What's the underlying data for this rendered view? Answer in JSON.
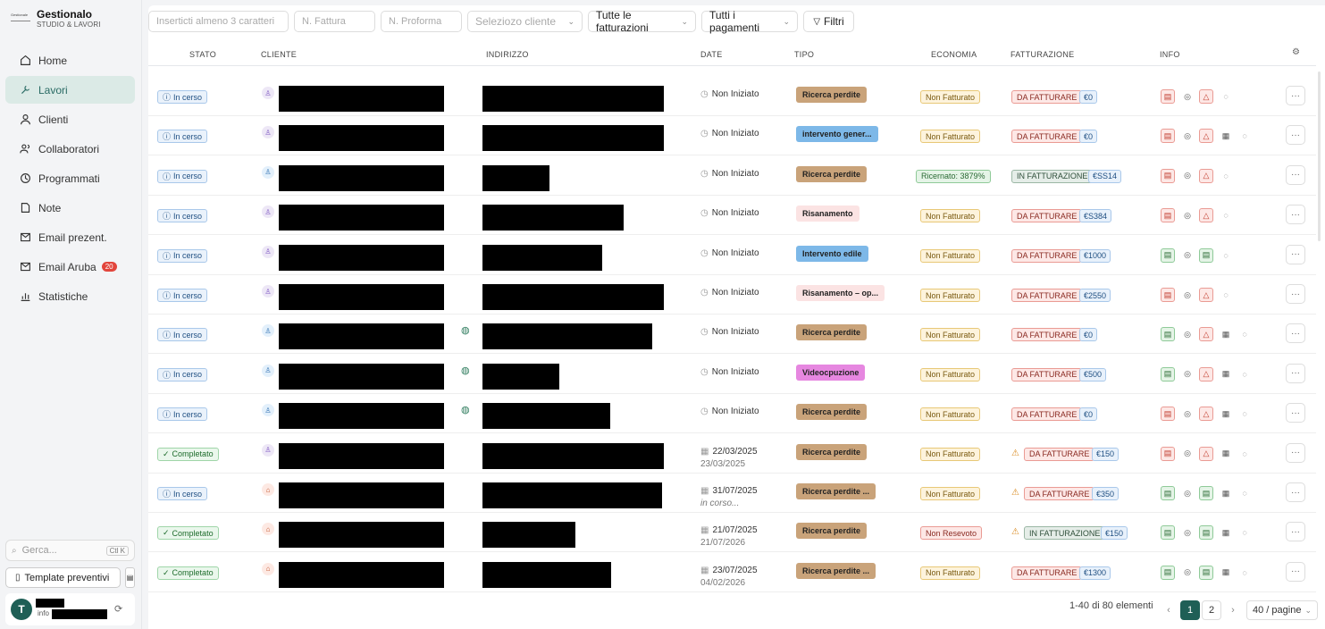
{
  "app": {
    "title": "Gestionalo",
    "subtitle": "STUDIO & LAVORI",
    "logo_text": "Gestionale"
  },
  "sidebar": {
    "items": [
      {
        "label": "Home",
        "icon": "home-icon"
      },
      {
        "label": "Lavori",
        "icon": "wrench-icon",
        "active": true
      },
      {
        "label": "Clienti",
        "icon": "user-icon"
      },
      {
        "label": "Collaboratori",
        "icon": "users-icon"
      },
      {
        "label": "Programmati",
        "icon": "clock-icon"
      },
      {
        "label": "Note",
        "icon": "note-icon"
      },
      {
        "label": "Email prezent.",
        "icon": "mail-icon"
      },
      {
        "label": "Email Aruba",
        "icon": "mail-icon",
        "badge": "20"
      },
      {
        "label": "Statistiche",
        "icon": "chart-icon"
      }
    ],
    "search_placeholder": "Gerca...",
    "search_shortcut": "Ctl K",
    "template_label": "Template preventivi",
    "user_initial": "T",
    "user_mail_prefix": "info"
  },
  "toolbar": {
    "search_placeholder": "Inserticti almeno 3 caratteri",
    "fattura_placeholder": "N. Fattura",
    "proforma_placeholder": "N. Proforma",
    "cliente_placeholder": "Seleziozo cliente",
    "fatturazioni": "Tutte le fatturazioni",
    "pagamenti": "Tutti i pagamenti",
    "filtri": "Filtri"
  },
  "table": {
    "headers": {
      "stato": "STATO",
      "cliente": "CLIENTE",
      "indirizzo": "INDIRIZZO",
      "date": "DATE",
      "tipo": "TIPO",
      "economia": "ECONOMIA",
      "fatturazione": "FATTURAZIONE",
      "info": "INFO"
    },
    "rows": [
      {
        "stato": "In cerso",
        "st": "inc",
        "ci": "p",
        "cw": 185,
        "aw": 203,
        "globe": false,
        "d1": "Non Iniziato",
        "d2": "",
        "tipo": "Ricerca perdite",
        "tc": "#c9a37a",
        "eco": "Non Fatturato",
        "ec": "nf",
        "warn": false,
        "fatt": "DA FATTURARE",
        "fc": "da",
        "amt": "€0",
        "pdf": "r",
        "alert": true,
        "cal": false
      },
      {
        "stato": "In cerso",
        "st": "inc",
        "ci": "p",
        "cw": 185,
        "aw": 203,
        "globe": false,
        "d1": "Non Iniziato",
        "d2": "",
        "tipo": "intervento gener...",
        "tc": "#7db8e8",
        "eco": "Non Fatturato",
        "ec": "nf",
        "warn": false,
        "fatt": "DA FATTURARE",
        "fc": "da",
        "amt": "€0",
        "pdf": "r",
        "alert": true,
        "cal": true
      },
      {
        "stato": "In cerso",
        "st": "inc",
        "ci": "b",
        "cw": 185,
        "aw": 75,
        "globe": false,
        "d1": "Non Iniziato",
        "d2": "",
        "tipo": "Ricerca perdite",
        "tc": "#c9a37a",
        "eco": "Ricernato: 3879%",
        "ec": "ric",
        "warn": false,
        "fatt": "IN FATTURAZIONE",
        "fc": "in",
        "amt": "€SS14",
        "pdf": "r",
        "alert": true,
        "cal": false
      },
      {
        "stato": "In cerso",
        "st": "inc",
        "ci": "p",
        "cw": 185,
        "aw": 158,
        "globe": false,
        "d1": "Non Iniziato",
        "d2": "",
        "tipo": "Risanamento",
        "tc": "#fbe3e3",
        "eco": "Non Fatturato",
        "ec": "nf",
        "warn": false,
        "fatt": "DA FATTURARE",
        "fc": "da",
        "amt": "€S384",
        "pdf": "r",
        "alert": true,
        "cal": false
      },
      {
        "stato": "In cerso",
        "st": "inc",
        "ci": "p",
        "cw": 185,
        "aw": 134,
        "globe": false,
        "d1": "Non Iniziato",
        "d2": "",
        "tipo": "Intervento edile",
        "tc": "#7db8e8",
        "eco": "Non Fatturato",
        "ec": "nf",
        "warn": false,
        "fatt": "DA FATTURARE",
        "fc": "da",
        "amt": "€1000",
        "pdf": "g",
        "alert": false,
        "cal": false
      },
      {
        "stato": "In cerso",
        "st": "inc",
        "ci": "p",
        "cw": 185,
        "aw": 203,
        "globe": false,
        "d1": "Non Iniziato",
        "d2": "",
        "tipo": "Risanamento – op...",
        "tc": "#fbe3e3",
        "eco": "Non Fatturato",
        "ec": "nf",
        "warn": false,
        "fatt": "DA FATTURARE",
        "fc": "da",
        "amt": "€2550",
        "pdf": "r",
        "alert": true,
        "cal": false
      },
      {
        "stato": "In cerso",
        "st": "inc",
        "ci": "b",
        "cw": 185,
        "aw": 190,
        "globe": true,
        "d1": "Non Iniziato",
        "d2": "",
        "tipo": "Ricerca perdite",
        "tc": "#c9a37a",
        "eco": "Non Fatturato",
        "ec": "nf",
        "warn": false,
        "fatt": "DA FATTURARE",
        "fc": "da",
        "amt": "€0",
        "pdf": "g",
        "alert": true,
        "cal": true
      },
      {
        "stato": "In cerso",
        "st": "inc",
        "ci": "b",
        "cw": 185,
        "aw": 86,
        "globe": true,
        "d1": "Non Iniziato",
        "d2": "",
        "tipo": "Videocpuzione",
        "tc": "#e687e0",
        "eco": "Non Fatturato",
        "ec": "nf",
        "warn": false,
        "fatt": "DA FATTURARE",
        "fc": "da",
        "amt": "€500",
        "pdf": "g",
        "alert": true,
        "cal": true
      },
      {
        "stato": "In cerso",
        "st": "inc",
        "ci": "b",
        "cw": 185,
        "aw": 143,
        "globe": true,
        "d1": "Non Iniziato",
        "d2": "",
        "tipo": "Ricerca perdite",
        "tc": "#c9a37a",
        "eco": "Non Fatturato",
        "ec": "nf",
        "warn": false,
        "fatt": "DA FATTURARE",
        "fc": "da",
        "amt": "€0",
        "pdf": "r",
        "alert": true,
        "cal": true
      },
      {
        "stato": "Completato",
        "st": "comp",
        "ci": "p",
        "cw": 185,
        "aw": 203,
        "globe": false,
        "d1": "22/03/2025",
        "d2": "23/03/2025",
        "tipo": "Ricerca perdite",
        "tc": "#c9a37a",
        "eco": "Non Fatturato",
        "ec": "nf",
        "warn": true,
        "fatt": "DA FATTURARE",
        "fc": "da",
        "amt": "€150",
        "pdf": "r",
        "alert": true,
        "cal": true
      },
      {
        "stato": "In cerso",
        "st": "inc",
        "ci": "o",
        "cw": 185,
        "aw": 201,
        "globe": false,
        "d1": "31/07/2025",
        "d2": "in corso...",
        "tipo": "Ricerca perdite ...",
        "tc": "#c9a37a",
        "eco": "Non Fatturato",
        "ec": "nf",
        "warn": true,
        "fatt": "DA FATTURARE",
        "fc": "da",
        "amt": "€350",
        "pdf": "g",
        "alert": false,
        "cal": true
      },
      {
        "stato": "Completato",
        "st": "comp",
        "ci": "o",
        "cw": 185,
        "aw": 104,
        "globe": false,
        "d1": "21/07/2025",
        "d2": "21/07/2026",
        "tipo": "Ricerca perdite",
        "tc": "#c9a37a",
        "eco": "Non Resevoto",
        "ec": "nr",
        "warn": true,
        "fatt": "IN FATTURAZIONE",
        "fc": "in",
        "amt": "€150",
        "pdf": "g",
        "alert": false,
        "cal": true
      },
      {
        "stato": "Completato",
        "st": "comp",
        "ci": "o",
        "cw": 185,
        "aw": 144,
        "globe": false,
        "d1": "23/07/2025",
        "d2": "04/02/2026",
        "tipo": "Ricerca perdite ...",
        "tc": "#c9a37a",
        "eco": "Non Fatturato",
        "ec": "nf",
        "warn": false,
        "fatt": "DA FATTURARE",
        "fc": "da",
        "amt": "€1300",
        "pdf": "g",
        "alert": false,
        "cal": true
      }
    ]
  },
  "pagination": {
    "summary": "1-40 di 80 elementi",
    "pages": [
      "1",
      "2"
    ],
    "current": "1",
    "per_page": "40 / pagine"
  }
}
